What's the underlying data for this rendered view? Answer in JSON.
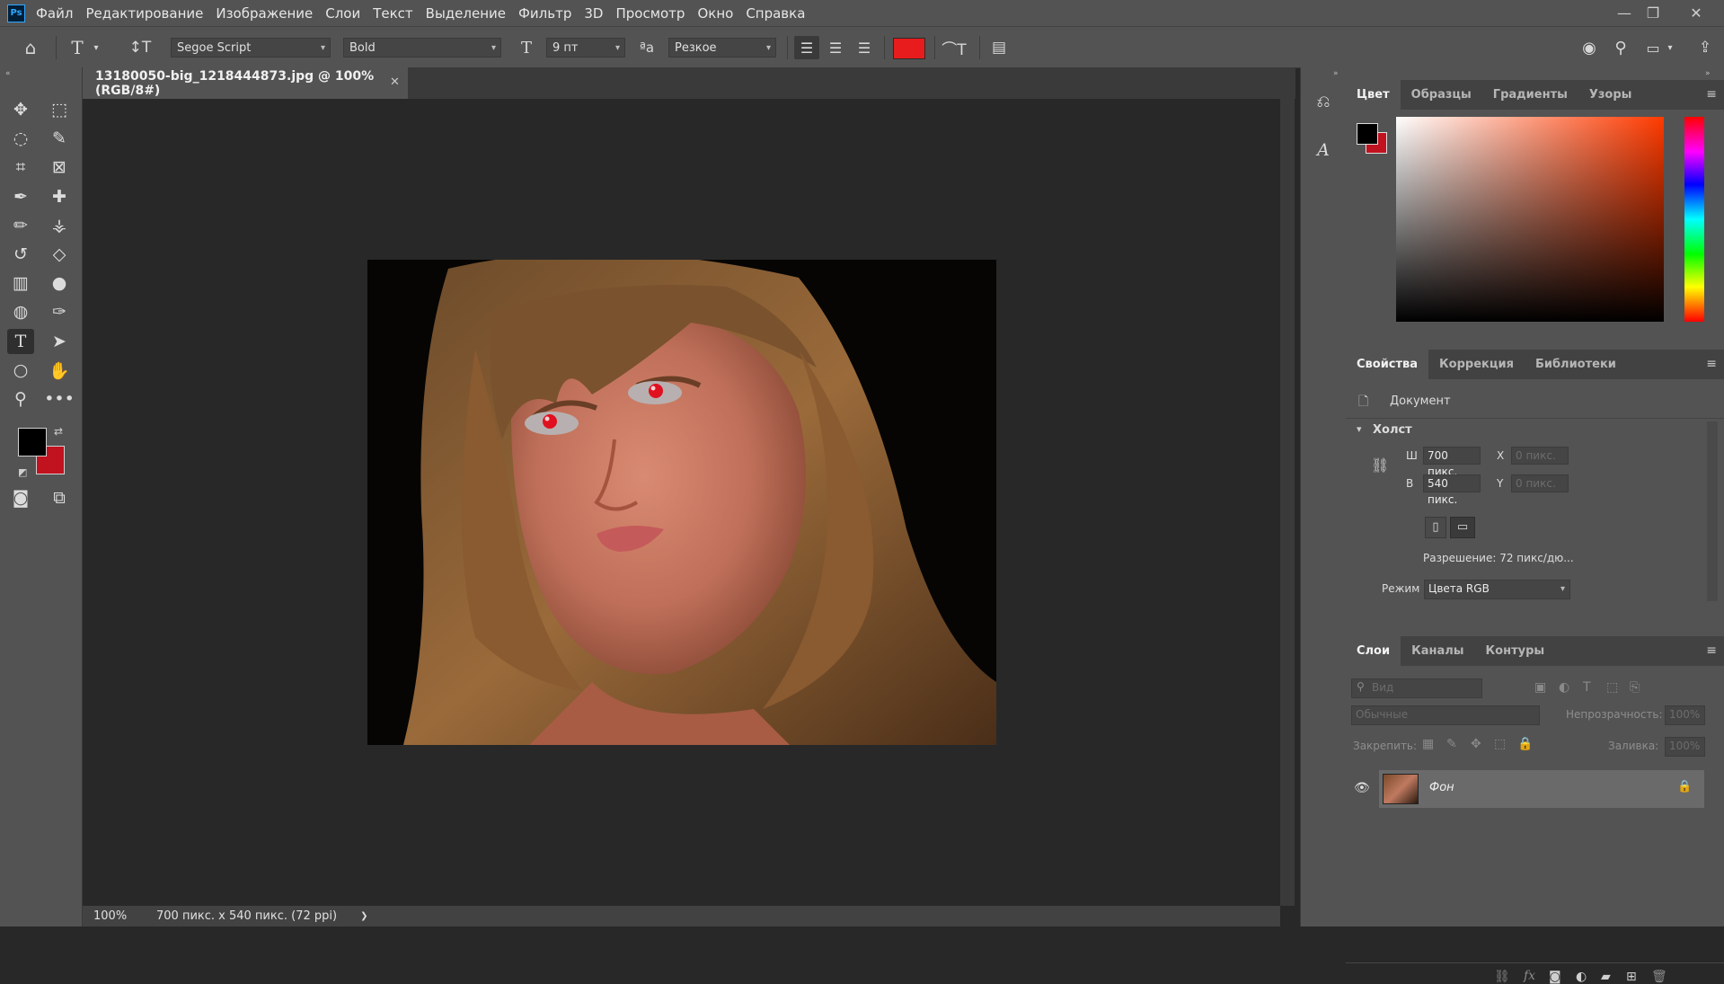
{
  "app": {
    "logo": "Ps"
  },
  "menu": [
    "Файл",
    "Редактирование",
    "Изображение",
    "Слои",
    "Текст",
    "Выделение",
    "Фильтр",
    "3D",
    "Просмотр",
    "Окно",
    "Справка"
  ],
  "window_controls": {
    "minimize": "—",
    "restore": "❐",
    "close": "✕"
  },
  "options": {
    "font_family": "Segoe Script",
    "font_style": "Bold",
    "font_size": "9 пт",
    "antialias": "Резкое",
    "text_color": "#e81c1c"
  },
  "document": {
    "tab_title": "13180050-big_1218444873.jpg @ 100% (RGB/8#)",
    "zoom": "100%",
    "status": "700 пикс. x 540 пикс. (72 ppi)",
    "status_arrow": "❯"
  },
  "colors": {
    "foreground": "#000000",
    "background": "#c1121f"
  },
  "color_panel": {
    "tabs": [
      "Цвет",
      "Образцы",
      "Градиенты",
      "Узоры"
    ],
    "active_tab": 0
  },
  "properties_panel": {
    "tabs": [
      "Свойства",
      "Коррекция",
      "Библиотеки"
    ],
    "doc_label": "Документ",
    "section": "Холст",
    "w_label": "Ш",
    "w_value": "700 пикс.",
    "h_label": "В",
    "h_value": "540 пикс.",
    "x_label": "X",
    "x_placeholder": "0 пикс.",
    "y_label": "Y",
    "y_placeholder": "0 пикс.",
    "resolution": "Разрешение: 72 пикс/дю...",
    "mode_label": "Режим",
    "mode_value": "Цвета RGB"
  },
  "layers_panel": {
    "tabs": [
      "Слои",
      "Каналы",
      "Контуры"
    ],
    "filter_placeholder": "Вид",
    "blend_mode": "Обычные",
    "opacity_label": "Непрозрачность:",
    "opacity_value": "100%",
    "lock_label": "Закрепить:",
    "fill_label": "Заливка:",
    "fill_value": "100%",
    "layers": [
      {
        "name": "Фон"
      }
    ]
  }
}
